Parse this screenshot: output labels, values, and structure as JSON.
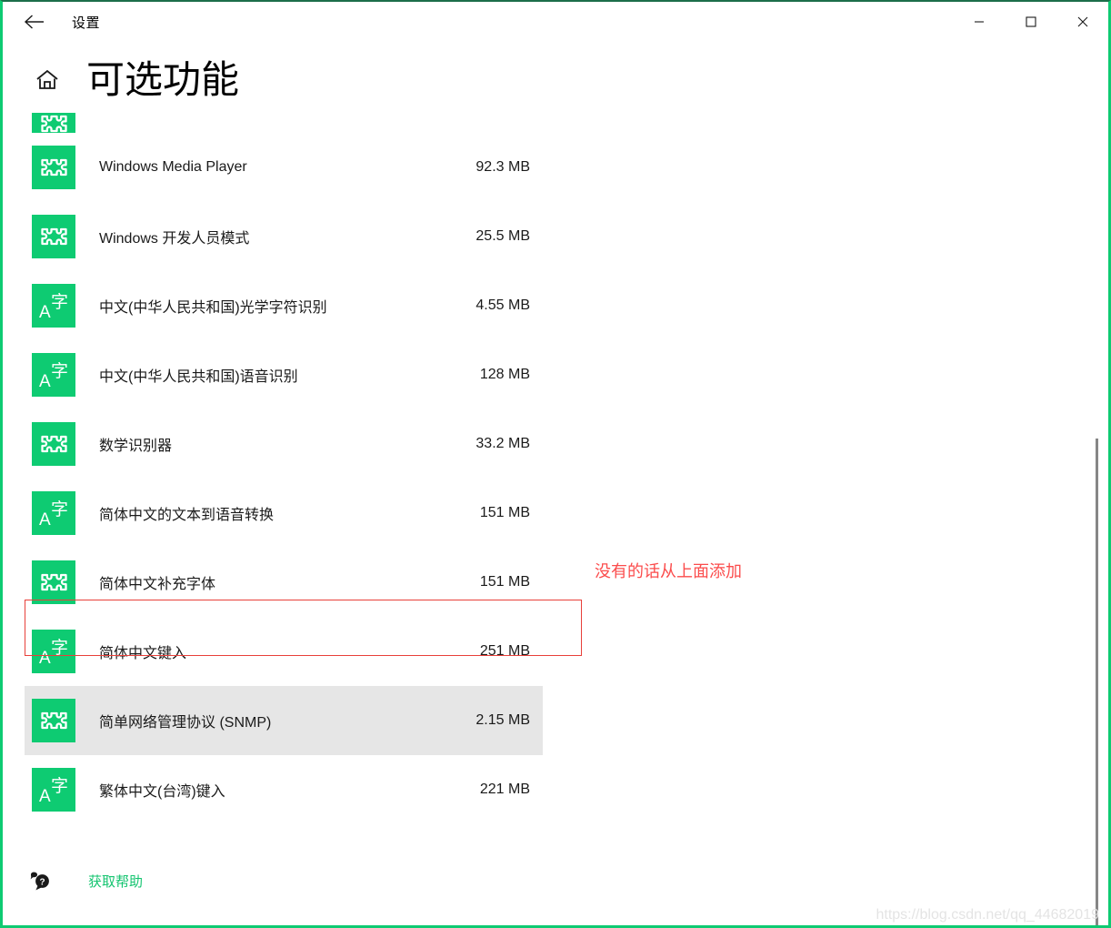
{
  "window": {
    "app_title": "设置",
    "back_icon": "back-arrow-icon",
    "minimize_label": "—",
    "maximize_label": "□",
    "close_label": "✕",
    "accent_color": "#0ecb72",
    "border_top_color": "#1c6e4a"
  },
  "page": {
    "home_icon": "home-icon",
    "title": "可选功能"
  },
  "list": {
    "items": [
      {
        "icon": "puzzle-icon",
        "label": "",
        "size": "",
        "clipped": true,
        "selected": false
      },
      {
        "icon": "puzzle-icon",
        "label": "Windows Media Player",
        "size": "92.3 MB",
        "clipped": false,
        "selected": false
      },
      {
        "icon": "puzzle-icon",
        "label": "Windows 开发人员模式",
        "size": "25.5 MB",
        "clipped": false,
        "selected": false
      },
      {
        "icon": "language-icon",
        "label": "中文(中华人民共和国)光学字符识别",
        "size": "4.55 MB",
        "clipped": false,
        "selected": false
      },
      {
        "icon": "language-icon",
        "label": "中文(中华人民共和国)语音识别",
        "size": "128 MB",
        "clipped": false,
        "selected": false
      },
      {
        "icon": "puzzle-icon",
        "label": "数学识别器",
        "size": "33.2 MB",
        "clipped": false,
        "selected": false
      },
      {
        "icon": "language-icon",
        "label": "简体中文的文本到语音转换",
        "size": "151 MB",
        "clipped": false,
        "selected": false
      },
      {
        "icon": "puzzle-icon",
        "label": "简体中文补充字体",
        "size": "151 MB",
        "clipped": false,
        "selected": false
      },
      {
        "icon": "language-icon",
        "label": "简体中文键入",
        "size": "251 MB",
        "clipped": false,
        "selected": false
      },
      {
        "icon": "puzzle-icon",
        "label": "简单网络管理协议 (SNMP)",
        "size": "2.15 MB",
        "clipped": false,
        "selected": true
      },
      {
        "icon": "language-icon",
        "label": "繁体中文(台湾)键入",
        "size": "221 MB",
        "clipped": false,
        "selected": false
      }
    ]
  },
  "annotation": {
    "text": "没有的话从上面添加",
    "color": "#fb4c4c",
    "box_color": "#e8403a"
  },
  "footer": {
    "help_icon": "help-chat-icon",
    "help_text": "获取帮助",
    "help_color": "#13c46f"
  },
  "watermark": {
    "text": "https://blog.csdn.net/qq_44682019"
  }
}
